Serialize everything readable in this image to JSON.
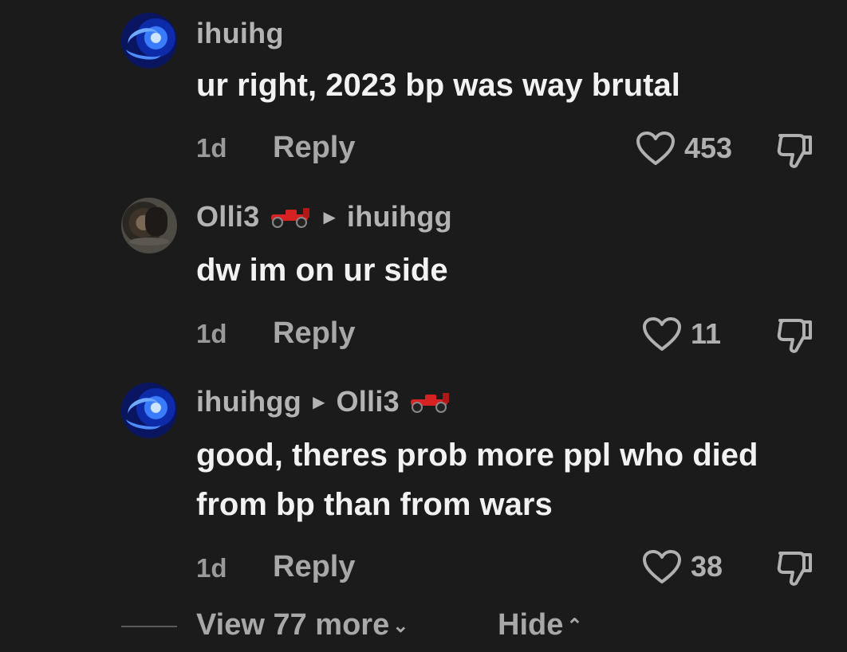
{
  "comments": [
    {
      "username": "ihuihg",
      "reply_to": "",
      "text": "ur right, 2023 bp was way brutal",
      "time": "1d",
      "reply_label": "Reply",
      "likes": "453",
      "avatar": "blue-eye-avatar"
    },
    {
      "username": "Olli3",
      "user_badge": "race-car-emoji",
      "reply_to": "ihuihgg",
      "text": "dw im on ur side",
      "time": "1d",
      "reply_label": "Reply",
      "likes": "11",
      "avatar": "dark-photo-avatar"
    },
    {
      "username": "ihuihgg",
      "reply_to": "Olli3",
      "reply_to_badge": "race-car-emoji",
      "text": "good, theres prob more ppl who died from bp than from wars",
      "time": "1d",
      "reply_label": "Reply",
      "likes": "38",
      "avatar": "blue-eye-avatar"
    }
  ],
  "footer": {
    "view_more": "View 77 more",
    "hide": "Hide"
  },
  "colors": {
    "background": "#1b1b1b",
    "text": "#f2f2f2",
    "muted": "#a8a8a8"
  }
}
